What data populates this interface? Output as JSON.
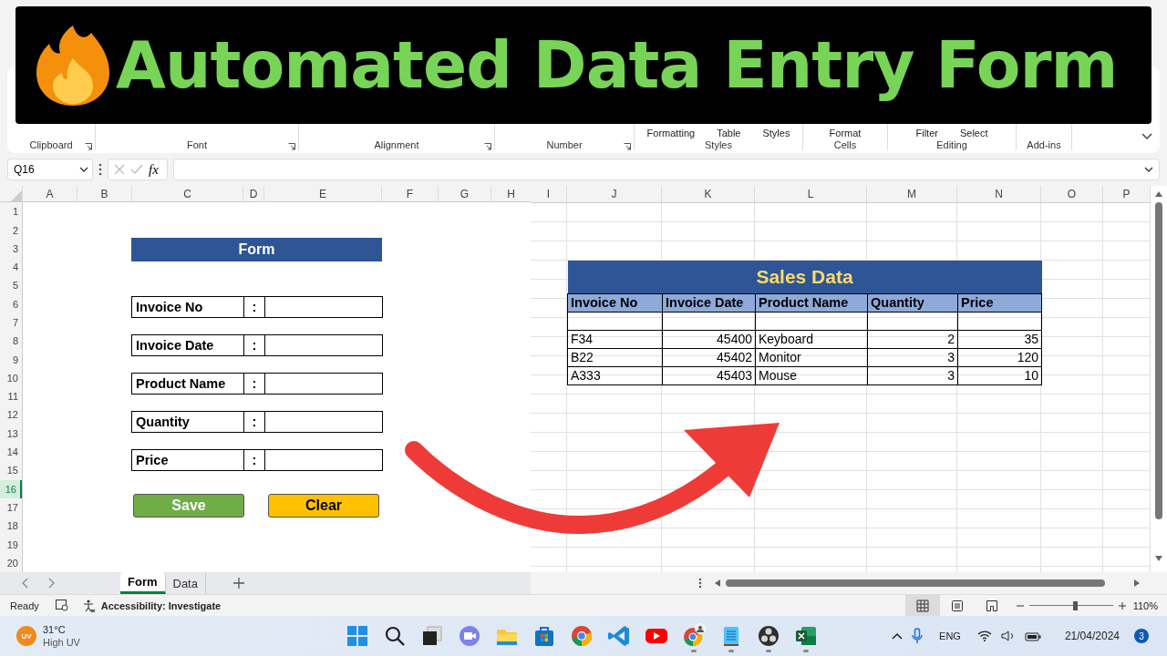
{
  "banner": {
    "title": "Automated Data Entry Form"
  },
  "ribbon": {
    "groups": [
      {
        "label": "Clipboard",
        "launcher": true
      },
      {
        "label": "Font",
        "launcher": true
      },
      {
        "label": "Alignment",
        "launcher": true
      },
      {
        "label": "Number",
        "launcher": true
      },
      {
        "label": "Styles",
        "launcher": false,
        "commands": [
          "Formatting",
          "Table",
          "Styles"
        ]
      },
      {
        "label": "Cells",
        "launcher": false,
        "commands": [
          "Format"
        ]
      },
      {
        "label": "Editing",
        "launcher": false,
        "commands": [
          "Filter",
          "Select"
        ]
      },
      {
        "label": "Add-ins",
        "launcher": false
      }
    ]
  },
  "formula_bar": {
    "name_box": "Q16",
    "function_label": "fx"
  },
  "form_sheet": {
    "columns": [
      "A",
      "B",
      "C",
      "D",
      "E",
      "F",
      "G",
      "H"
    ],
    "rows": [
      {
        "label": "1",
        "selected": false
      },
      {
        "label": "2",
        "selected": false
      },
      {
        "label": "3",
        "selected": false
      },
      {
        "label": "4",
        "selected": false
      },
      {
        "label": "5",
        "selected": false
      },
      {
        "label": "6",
        "selected": false
      },
      {
        "label": "7",
        "selected": false
      },
      {
        "label": "8",
        "selected": false
      },
      {
        "label": "9",
        "selected": false
      },
      {
        "label": "10",
        "selected": false
      },
      {
        "label": "11",
        "selected": false
      },
      {
        "label": "12",
        "selected": false
      },
      {
        "label": "13",
        "selected": false
      },
      {
        "label": "14",
        "selected": false
      },
      {
        "label": "15",
        "selected": false
      },
      {
        "label": "16",
        "selected": true
      },
      {
        "label": "17",
        "selected": false
      },
      {
        "label": "18",
        "selected": false
      },
      {
        "label": "19",
        "selected": false
      },
      {
        "label": "20",
        "selected": false
      }
    ],
    "title": "Form",
    "fields": [
      {
        "label": "Invoice No",
        "separator": ":"
      },
      {
        "label": "Invoice Date",
        "separator": ":"
      },
      {
        "label": "Product Name",
        "separator": ":"
      },
      {
        "label": "Quantity",
        "separator": ":"
      },
      {
        "label": "Price",
        "separator": ":"
      }
    ],
    "buttons": [
      {
        "label": "Save",
        "color": "#70ad47"
      },
      {
        "label": "Clear",
        "color": "#ffc000"
      }
    ]
  },
  "data_sheet": {
    "columns": [
      "I",
      "J",
      "K",
      "L",
      "M",
      "N",
      "O",
      "P"
    ],
    "table": {
      "title": "Sales Data",
      "columns": [
        {
          "label": "Invoice No",
          "numeric": false
        },
        {
          "label": "Invoice Date",
          "numeric": true
        },
        {
          "label": "Product Name",
          "numeric": false
        },
        {
          "label": "Quantity",
          "numeric": true
        },
        {
          "label": "Price",
          "numeric": true
        }
      ],
      "rows": [
        {
          "kind": "blank"
        },
        {
          "kind": "data",
          "cells": [
            "F34",
            "45400",
            "Keyboard",
            "2",
            "35"
          ]
        },
        {
          "kind": "data",
          "cells": [
            "B22",
            "45402",
            "Monitor",
            "3",
            "120"
          ]
        },
        {
          "kind": "data",
          "cells": [
            "A333",
            "45403",
            "Mouse",
            "3",
            "10"
          ]
        }
      ]
    }
  },
  "sheet_tabs": [
    {
      "label": "Form",
      "selected": true
    },
    {
      "label": "Data",
      "selected": false
    }
  ],
  "status_bar": {
    "status": "Ready",
    "accessibility": "Accessibility: Investigate",
    "views": [
      {
        "kind": "normal",
        "selected": true
      },
      {
        "kind": "page_layout",
        "selected": false
      },
      {
        "kind": "page_break",
        "selected": false
      }
    ],
    "zoom": {
      "level": 0.55
    },
    "zoom_label": "110%"
  },
  "taskbar": {
    "weather": {
      "badge": "UV",
      "temperature": "31°C",
      "condition": "High UV"
    },
    "apps": [
      {
        "kind": "start",
        "running": false
      },
      {
        "kind": "search",
        "running": false
      },
      {
        "kind": "task_view",
        "running": false
      },
      {
        "kind": "chat",
        "running": false
      },
      {
        "kind": "explorer",
        "running": false
      },
      {
        "kind": "store",
        "running": false
      },
      {
        "kind": "chrome",
        "running": false
      },
      {
        "kind": "vscode",
        "running": false
      },
      {
        "kind": "youtube",
        "running": false
      },
      {
        "kind": "chrome_profile",
        "running": true
      },
      {
        "kind": "notepad",
        "running": true
      },
      {
        "kind": "obs",
        "running": true
      },
      {
        "kind": "excel",
        "running": true
      }
    ],
    "language": "ENG",
    "date": "21/04/2024",
    "notification_count": "3"
  }
}
